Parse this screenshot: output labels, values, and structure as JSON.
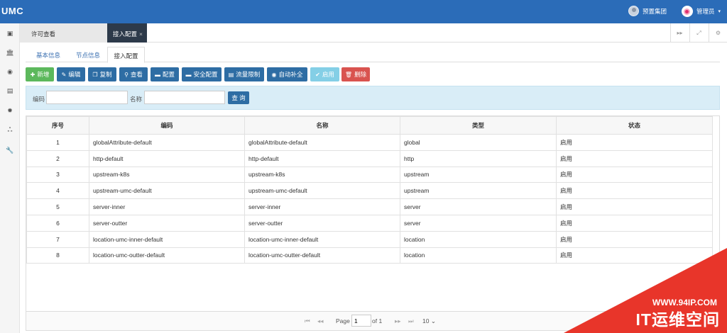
{
  "app": {
    "logo": "UMC"
  },
  "header": {
    "org": "预置集团",
    "user": "管理员",
    "caret": "▾"
  },
  "tabs": {
    "main": "许可查看",
    "active": "接入配置",
    "close": "×"
  },
  "tab_controls": [
    {
      "icon": "fast-forward-icon",
      "glyph": "▸▸"
    },
    {
      "icon": "fullscreen-icon",
      "glyph": "⤢"
    },
    {
      "icon": "settings-icon",
      "glyph": "⚙"
    }
  ],
  "sidebar": [
    {
      "icon": "id-card-icon",
      "glyph": "▣"
    },
    {
      "icon": "bank-icon",
      "glyph": "🏛"
    },
    {
      "icon": "eye-icon",
      "glyph": "◉"
    },
    {
      "icon": "list-icon",
      "glyph": "▤"
    },
    {
      "icon": "gear-icon",
      "glyph": "✹"
    },
    {
      "icon": "sitemap-icon",
      "glyph": "ஃ"
    },
    {
      "icon": "wrench-icon",
      "glyph": "🔧"
    }
  ],
  "subtabs": [
    "基本信息",
    "节点信息",
    "接入配置"
  ],
  "toolbar": {
    "add": "新增",
    "edit": "编辑",
    "copy": "复制",
    "view": "查看",
    "config": "配置",
    "security": "安全配置",
    "throttle": "流量限制",
    "autofill": "自动补全",
    "enable": "启用",
    "delete": "删除"
  },
  "search": {
    "code_label": "编码",
    "name_label": "名称",
    "code_value": "",
    "name_value": "",
    "query": "查 询"
  },
  "table": {
    "headers": [
      "序号",
      "编码",
      "名称",
      "类型",
      "状态"
    ],
    "rows": [
      [
        "1",
        "globalAttribute-default",
        "globalAttribute-default",
        "global",
        "启用"
      ],
      [
        "2",
        "http-default",
        "http-default",
        "http",
        "启用"
      ],
      [
        "3",
        "upstream-k8s",
        "upstream-k8s",
        "upstream",
        "启用"
      ],
      [
        "4",
        "upstream-umc-default",
        "upstream-umc-default",
        "upstream",
        "启用"
      ],
      [
        "5",
        "server-inner",
        "server-inner",
        "server",
        "启用"
      ],
      [
        "6",
        "server-outter",
        "server-outter",
        "server",
        "启用"
      ],
      [
        "7",
        "location-umc-inner-default",
        "location-umc-inner-default",
        "location",
        "启用"
      ],
      [
        "8",
        "location-umc-outter-default",
        "location-umc-outter-default",
        "location",
        "启用"
      ]
    ]
  },
  "pager": {
    "page_label": "Page",
    "page_value": "1",
    "of": "of 1",
    "size": "10",
    "caret": "⌄"
  },
  "watermark": {
    "url": "WWW.94IP.COM",
    "brand": "IT运维空间"
  }
}
